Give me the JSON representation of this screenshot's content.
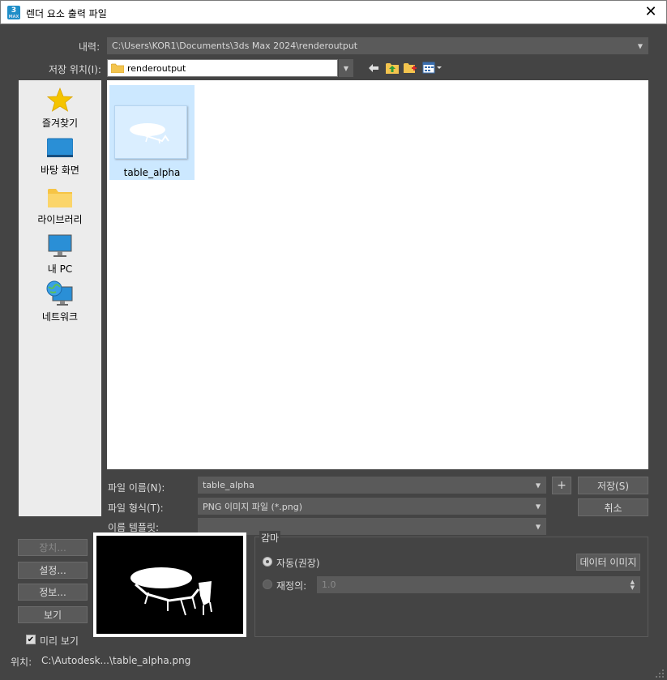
{
  "window": {
    "title": "렌더 요소 출력 파일",
    "app_icon_number": "3",
    "app_icon_sub": "MAX"
  },
  "history": {
    "label": "내력:",
    "value": "C:\\Users\\KOR1\\Documents\\3ds Max 2024\\renderoutput"
  },
  "savein": {
    "label": "저장 위치(I):",
    "value": "renderoutput"
  },
  "sidebar": {
    "items": [
      {
        "label": "즐겨찾기",
        "icon": "star-icon"
      },
      {
        "label": "바탕 화면",
        "icon": "desktop-icon"
      },
      {
        "label": "라이브러리",
        "icon": "folder-icon"
      },
      {
        "label": "내 PC",
        "icon": "computer-icon"
      },
      {
        "label": "네트워크",
        "icon": "network-icon"
      }
    ]
  },
  "files": [
    {
      "name": "table_alpha",
      "icon": "image-thumbnail"
    }
  ],
  "filename": {
    "label": "파일 이름(N):",
    "value": "table_alpha"
  },
  "filetype": {
    "label": "파일 형식(T):",
    "value": "PNG 이미지 파일 (*.png)"
  },
  "template": {
    "label": "이름 템플릿:",
    "value": ""
  },
  "buttons": {
    "plus": "+",
    "save": "저장(S)",
    "cancel": "취소",
    "devices": "장치...",
    "setup": "설정...",
    "info": "정보...",
    "view": "보기",
    "data_image": "데이터 이미지"
  },
  "gamma": {
    "title": "감마",
    "auto": "자동(권장)",
    "override": "재정의:",
    "override_value": "1.0"
  },
  "preview_check": {
    "label": "미리 보기",
    "checked": true,
    "mark": "✔"
  },
  "location": {
    "label": "위치:",
    "value": "C:\\Autodesk...\\table_alpha.png"
  },
  "colors": {
    "accent": "#1f8ec8",
    "selection": "#cce8ff"
  }
}
